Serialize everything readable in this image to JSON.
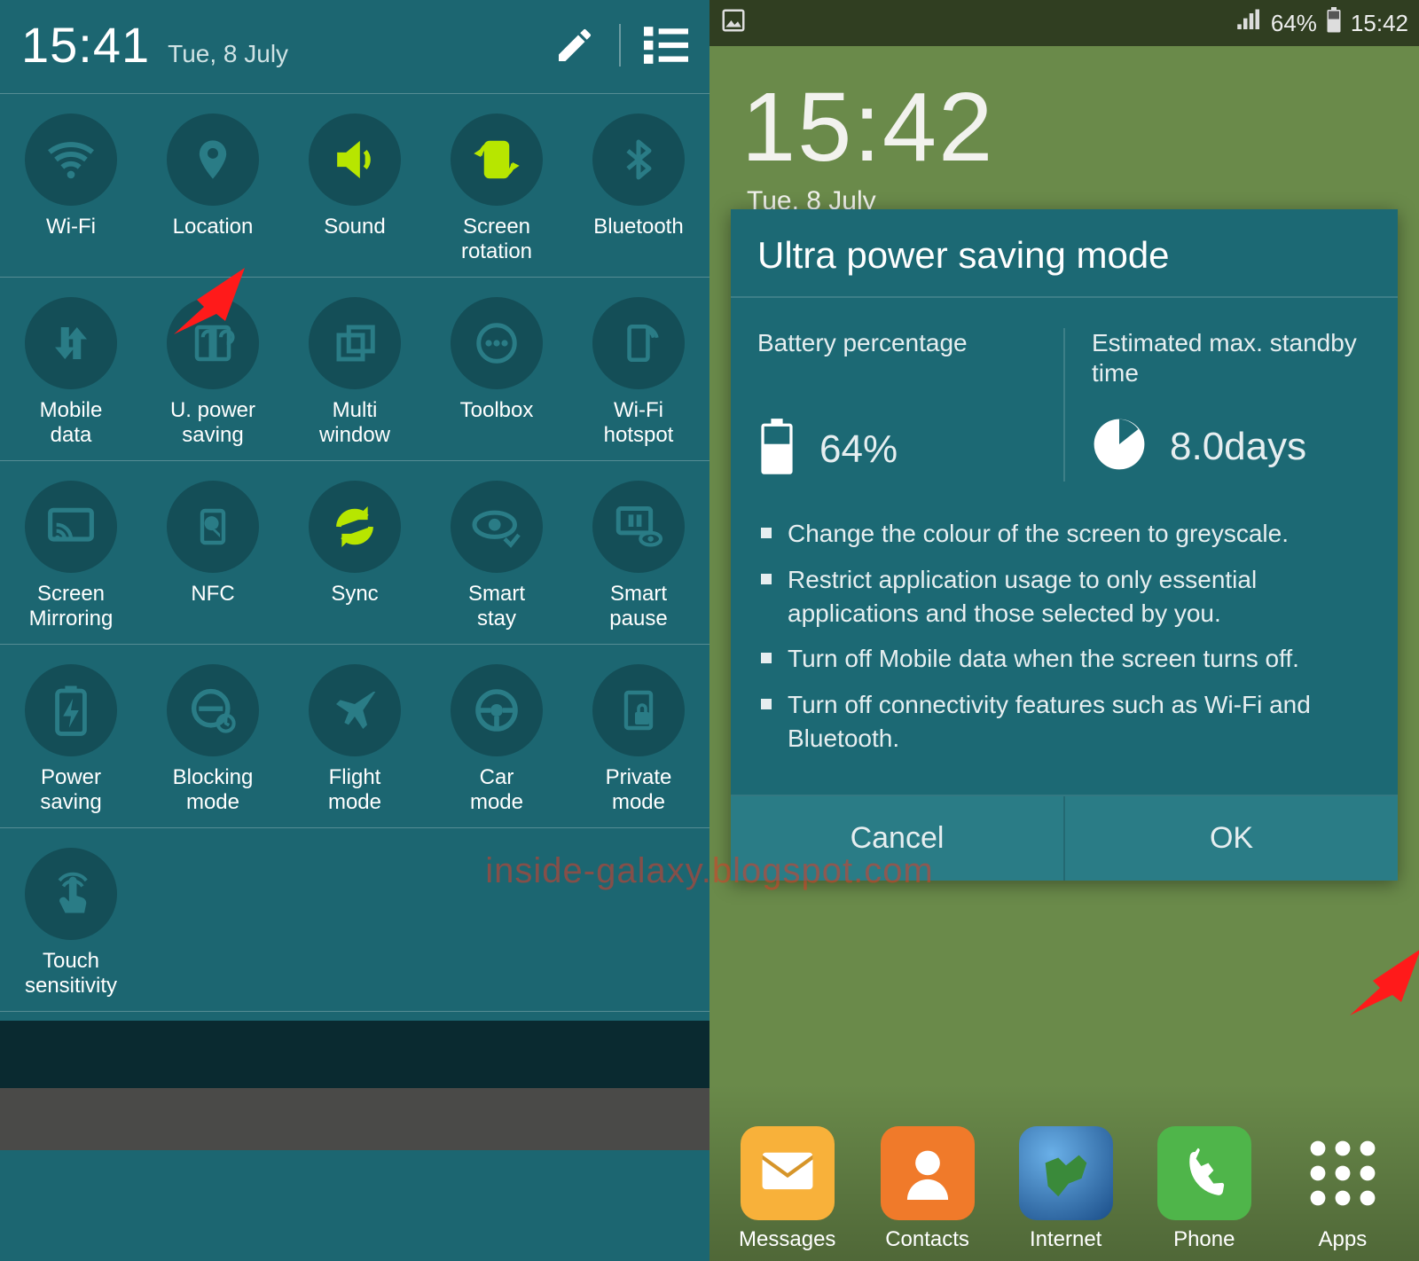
{
  "left": {
    "time": "15:41",
    "date": "Tue, 8 July",
    "toggles": [
      [
        {
          "label": "Wi-Fi"
        },
        {
          "label": "Location"
        },
        {
          "label": "Sound",
          "on": true
        },
        {
          "label": "Screen\nrotation",
          "on": true
        },
        {
          "label": "Bluetooth"
        }
      ],
      [
        {
          "label": "Mobile\ndata"
        },
        {
          "label": "U. power\nsaving"
        },
        {
          "label": "Multi\nwindow"
        },
        {
          "label": "Toolbox"
        },
        {
          "label": "Wi-Fi\nhotspot"
        }
      ],
      [
        {
          "label": "Screen\nMirroring"
        },
        {
          "label": "NFC"
        },
        {
          "label": "Sync",
          "on": true
        },
        {
          "label": "Smart\nstay"
        },
        {
          "label": "Smart\npause"
        }
      ],
      [
        {
          "label": "Power\nsaving"
        },
        {
          "label": "Blocking\nmode"
        },
        {
          "label": "Flight\nmode"
        },
        {
          "label": "Car\nmode"
        },
        {
          "label": "Private\nmode"
        }
      ],
      [
        {
          "label": "Touch\nsensitivity"
        }
      ]
    ]
  },
  "right": {
    "status": {
      "battery_pct": "64%",
      "time": "15:42"
    },
    "bg_time": "15:42",
    "bg_date": "Tue, 8 July",
    "dialog": {
      "title": "Ultra power saving mode",
      "battery_label": "Battery percentage",
      "battery_value": "64%",
      "standby_label": "Estimated max. standby time",
      "standby_value": "8.0days",
      "bullets": [
        "Change the colour of the screen to greyscale.",
        "Restrict application usage to only essential applications and those selected by you.",
        "Turn off Mobile data when the screen turns off.",
        "Turn off connectivity features such as Wi-Fi and Bluetooth."
      ],
      "cancel": "Cancel",
      "ok": "OK"
    },
    "dock": [
      {
        "label": "Messages",
        "color": "#f8b13a"
      },
      {
        "label": "Contacts",
        "color": "#f07a2a"
      },
      {
        "label": "Internet",
        "color": "#2f6fb3"
      },
      {
        "label": "Phone",
        "color": "#4fb54a"
      },
      {
        "label": "Apps",
        "color": "transparent"
      }
    ]
  },
  "watermark": "inside-galaxy.blogspot.com"
}
